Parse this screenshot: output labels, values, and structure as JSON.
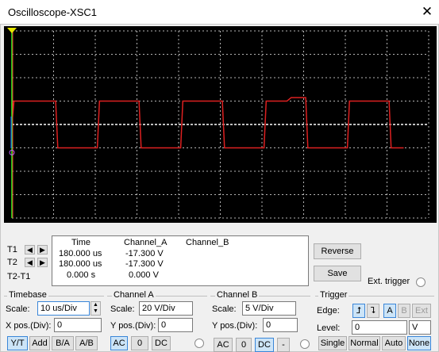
{
  "window": {
    "title": "Oscilloscope-XSC1",
    "close_glyph": "✕"
  },
  "readout": {
    "row_labels": [
      "T1",
      "T2",
      "T2-T1"
    ],
    "headers": {
      "time": "Time",
      "channel_a": "Channel_A",
      "channel_b": "Channel_B"
    },
    "rows": [
      {
        "time": "180.000 us",
        "channel_a": "-17.300 V",
        "channel_b": ""
      },
      {
        "time": "180.000 us",
        "channel_a": "-17.300 V",
        "channel_b": ""
      },
      {
        "time": "0.000 s",
        "channel_a": "0.000 V",
        "channel_b": ""
      }
    ],
    "arrow_left": "◀",
    "arrow_right": "▶"
  },
  "side_buttons": {
    "reverse": "Reverse",
    "save": "Save",
    "ext_trigger": "Ext. trigger"
  },
  "timebase": {
    "title": "Timebase",
    "scale_label": "Scale:",
    "scale_value": "10 us/Div",
    "xpos_label": "X pos.(Div):",
    "xpos_value": "0",
    "modes": [
      "Y/T",
      "Add",
      "B/A",
      "A/B"
    ],
    "selected_mode": "Y/T"
  },
  "channel_a": {
    "title": "Channel A",
    "scale_label": "Scale:",
    "scale_value": "20  V/Div",
    "ypos_label": "Y pos.(Div):",
    "ypos_value": "0",
    "coupling": [
      "AC",
      "0",
      "DC"
    ],
    "selected_coupling": "AC"
  },
  "channel_b": {
    "title": "Channel B",
    "scale_label": "Scale:",
    "scale_value": "5  V/Div",
    "ypos_label": "Y pos.(Div):",
    "ypos_value": "0",
    "coupling": [
      "AC",
      "0",
      "DC",
      "-"
    ],
    "selected_coupling": "DC"
  },
  "trigger": {
    "title": "Trigger",
    "edge_label": "Edge:",
    "edge_rising": "⮥",
    "edge_falling": "⮧",
    "sources": [
      "A",
      "B",
      "Ext"
    ],
    "selected_source": "A",
    "level_label": "Level:",
    "level_value": "0",
    "level_unit": "V",
    "modes": [
      "Single",
      "Normal",
      "Auto",
      "None"
    ],
    "selected_mode": "None"
  },
  "colors": {
    "screen_bg": "#000000",
    "grid": "#b4b4b4",
    "channel_a_trace": "#dd2020",
    "center_line": "#ffffff",
    "cursor_t1": "#ff3030",
    "cursor_t2": "#2060ff",
    "left_marker": "#e7e700",
    "y_axis_marker": "#20ff20"
  },
  "chart_data": {
    "type": "line",
    "xlim_div": [
      0,
      10
    ],
    "ylim_div": [
      -4,
      4
    ],
    "grid": true,
    "series": [
      {
        "x_div": [
          0,
          0.05,
          1.05,
          1.1,
          2.05,
          2.1,
          3.05,
          3.1,
          4.05,
          4.1,
          5.05,
          5.1,
          6.05,
          6.1,
          6.6,
          6.7,
          7.05,
          7.1,
          8.05,
          8.1,
          9.05,
          9.1,
          9.4
        ],
        "y_div": [
          0,
          1,
          1,
          -1,
          -1,
          1,
          1,
          -1,
          -1,
          1,
          1,
          -1,
          -1,
          1,
          1,
          1.15,
          1.15,
          -1,
          -1,
          1,
          1,
          -1,
          -1
        ]
      }
    ]
  }
}
